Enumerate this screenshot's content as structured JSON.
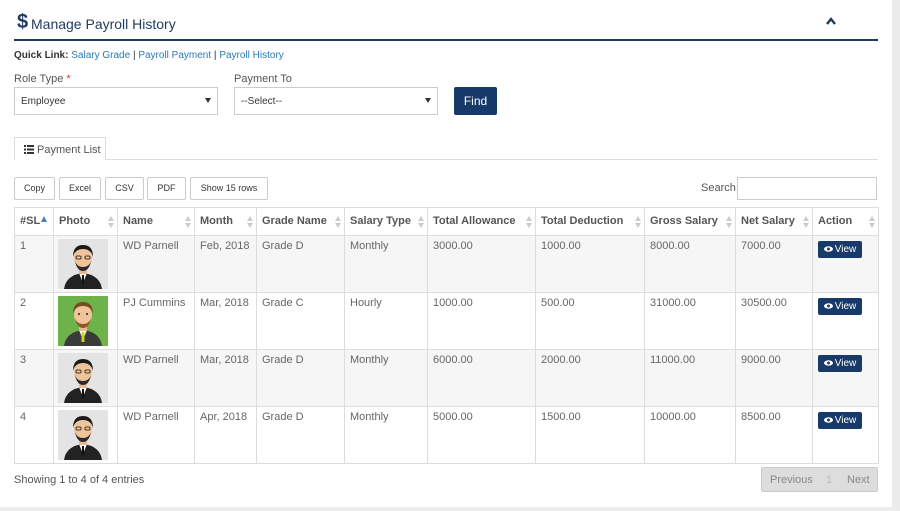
{
  "header": {
    "icon": "dollar-icon",
    "title": "Manage Payroll History",
    "collapse_icon": "chevron-up-icon"
  },
  "quick_links": {
    "label": "Quick Link:",
    "separator": "|",
    "links": [
      "Salary Grade",
      "Payroll Payment",
      "Payroll History"
    ]
  },
  "filters": {
    "role_type_label": "Role Type",
    "required_mark": "*",
    "role_type_value": "Employee",
    "payment_to_label": "Payment To",
    "payment_to_value": "--Select--",
    "find_label": "Find"
  },
  "tab": {
    "label": "Payment List",
    "icon": "list-icon"
  },
  "toolbar": {
    "buttons": [
      "Copy",
      "Excel",
      "CSV",
      "PDF",
      "Show 15 rows"
    ],
    "search_label": "Search:",
    "search_value": ""
  },
  "table": {
    "columns": [
      "#SL",
      "Photo",
      "Name",
      "Month",
      "Grade Name",
      "Salary Type",
      "Total Allowance",
      "Total Deduction",
      "Gross Salary",
      "Net Salary",
      "Action"
    ],
    "rows": [
      {
        "sl": "1",
        "photo": "male-avatar",
        "name": "WD Parnell",
        "month": "Feb, 2018",
        "grade": "Grade D",
        "salary_type": "Monthly",
        "allowance": "3000.00",
        "deduction": "1000.00",
        "gross": "8000.00",
        "net": "7000.00",
        "action": "View"
      },
      {
        "sl": "2",
        "photo": "male-avatar-green",
        "name": "PJ Cummins",
        "month": "Mar, 2018",
        "grade": "Grade C",
        "salary_type": "Hourly",
        "allowance": "1000.00",
        "deduction": "500.00",
        "gross": "31000.00",
        "net": "30500.00",
        "action": "View"
      },
      {
        "sl": "3",
        "photo": "male-avatar",
        "name": "WD Parnell",
        "month": "Mar, 2018",
        "grade": "Grade D",
        "salary_type": "Monthly",
        "allowance": "6000.00",
        "deduction": "2000.00",
        "gross": "11000.00",
        "net": "9000.00",
        "action": "View"
      },
      {
        "sl": "4",
        "photo": "male-avatar",
        "name": "WD Parnell",
        "month": "Apr, 2018",
        "grade": "Grade D",
        "salary_type": "Monthly",
        "allowance": "5000.00",
        "deduction": "1500.00",
        "gross": "10000.00",
        "net": "8500.00",
        "action": "View"
      }
    ]
  },
  "footer": {
    "info": "Showing 1 to 4 of 4 entries",
    "previous": "Previous",
    "page": "1",
    "next": "Next"
  },
  "colors": {
    "primary": "#173a6a",
    "link": "#2a7ab8",
    "required": "#ee3333"
  }
}
